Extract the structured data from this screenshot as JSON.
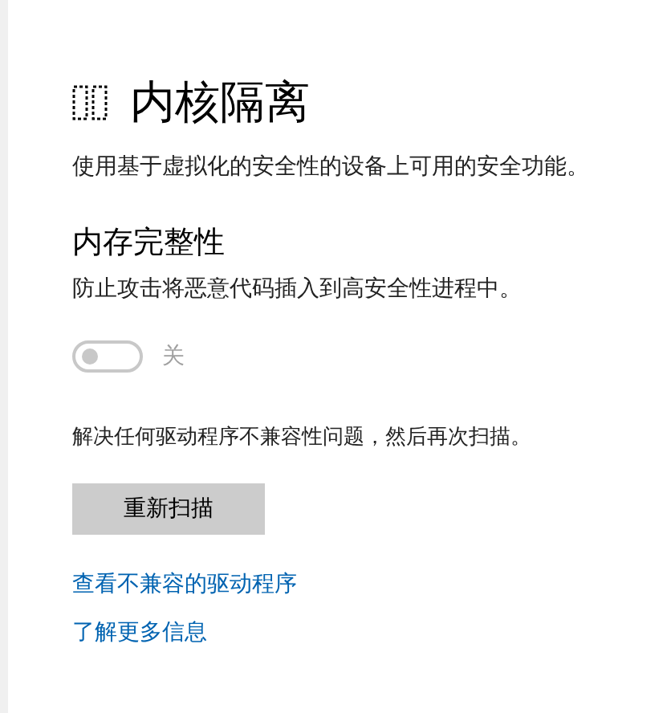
{
  "page": {
    "title": "内核隔离",
    "description": "使用基于虚拟化的安全性的设备上可用的安全功能。"
  },
  "setting": {
    "title": "内存完整性",
    "description": "防止攻击将恶意代码插入到高安全性进程中。",
    "on": false,
    "state_label": "关"
  },
  "notice": "解决任何驱动程序不兼容性问题，然后再次扫描。",
  "button": "重新扫描",
  "links": [
    "查看不兼容的驱动程序",
    "了解更多信息"
  ]
}
